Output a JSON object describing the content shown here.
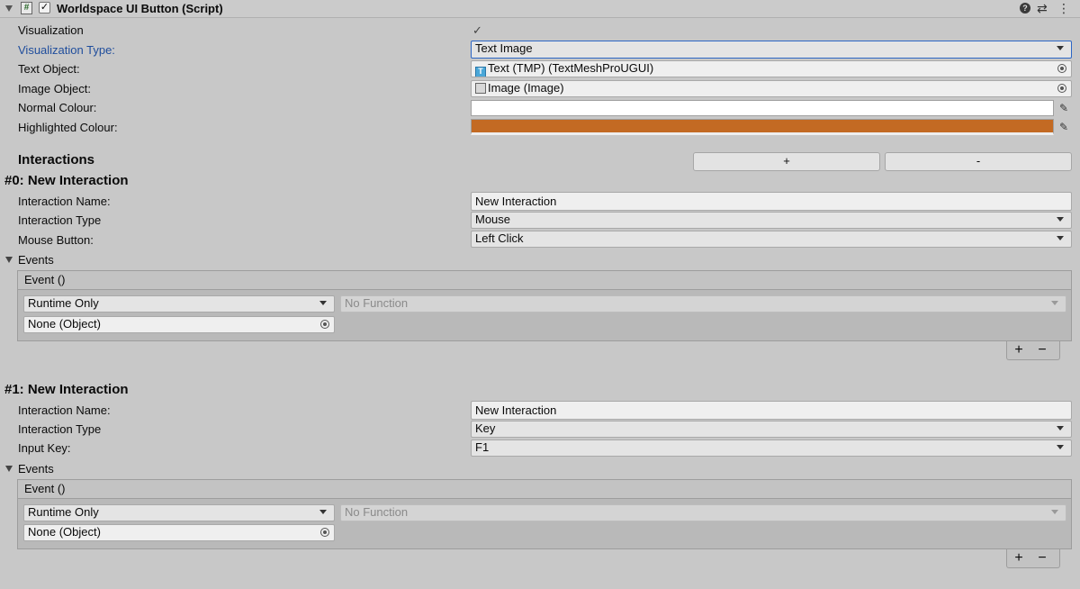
{
  "component": {
    "title": "Worldspace UI Button (Script)",
    "header_icon_text": "#",
    "enabled": true
  },
  "fields": {
    "visualization": {
      "label": "Visualization",
      "checked": true
    },
    "visualization_type": {
      "label": "Visualization Type:",
      "value": "Text Image"
    },
    "text_object": {
      "label": "Text Object:",
      "value": "Text (TMP) (TextMeshProUGUI)"
    },
    "image_object": {
      "label": "Image Object:",
      "value": "Image (Image)"
    },
    "normal_colour": {
      "label": "Normal Colour:",
      "color": "#ffffff"
    },
    "highlighted_colour": {
      "label": "Highlighted Colour:",
      "color": "#c36a23"
    }
  },
  "interactions": {
    "title": "Interactions",
    "add_label": "+",
    "remove_label": "-",
    "items": [
      {
        "header": "#0:  New Interaction",
        "name_label": "Interaction Name:",
        "name_value": "New Interaction",
        "type_label": "Interaction Type",
        "type_value": "Mouse",
        "extra_label": "Mouse Button:",
        "extra_value": "Left Click",
        "events_label": "Events",
        "event_header": "Event ()",
        "runtime": "Runtime Only",
        "function": "No Function",
        "object": "None (Object)",
        "plus": "+",
        "minus": "−"
      },
      {
        "header": "#1:  New Interaction",
        "name_label": "Interaction Name:",
        "name_value": "New Interaction",
        "type_label": "Interaction Type",
        "type_value": "Key",
        "extra_label": "Input Key:",
        "extra_value": "F1",
        "events_label": "Events",
        "event_header": "Event ()",
        "runtime": "Runtime Only",
        "function": "No Function",
        "object": "None (Object)",
        "plus": "+",
        "minus": "−"
      }
    ]
  },
  "colors": {
    "link_label": "#1f4d9c",
    "background": "#c8c8c8"
  }
}
